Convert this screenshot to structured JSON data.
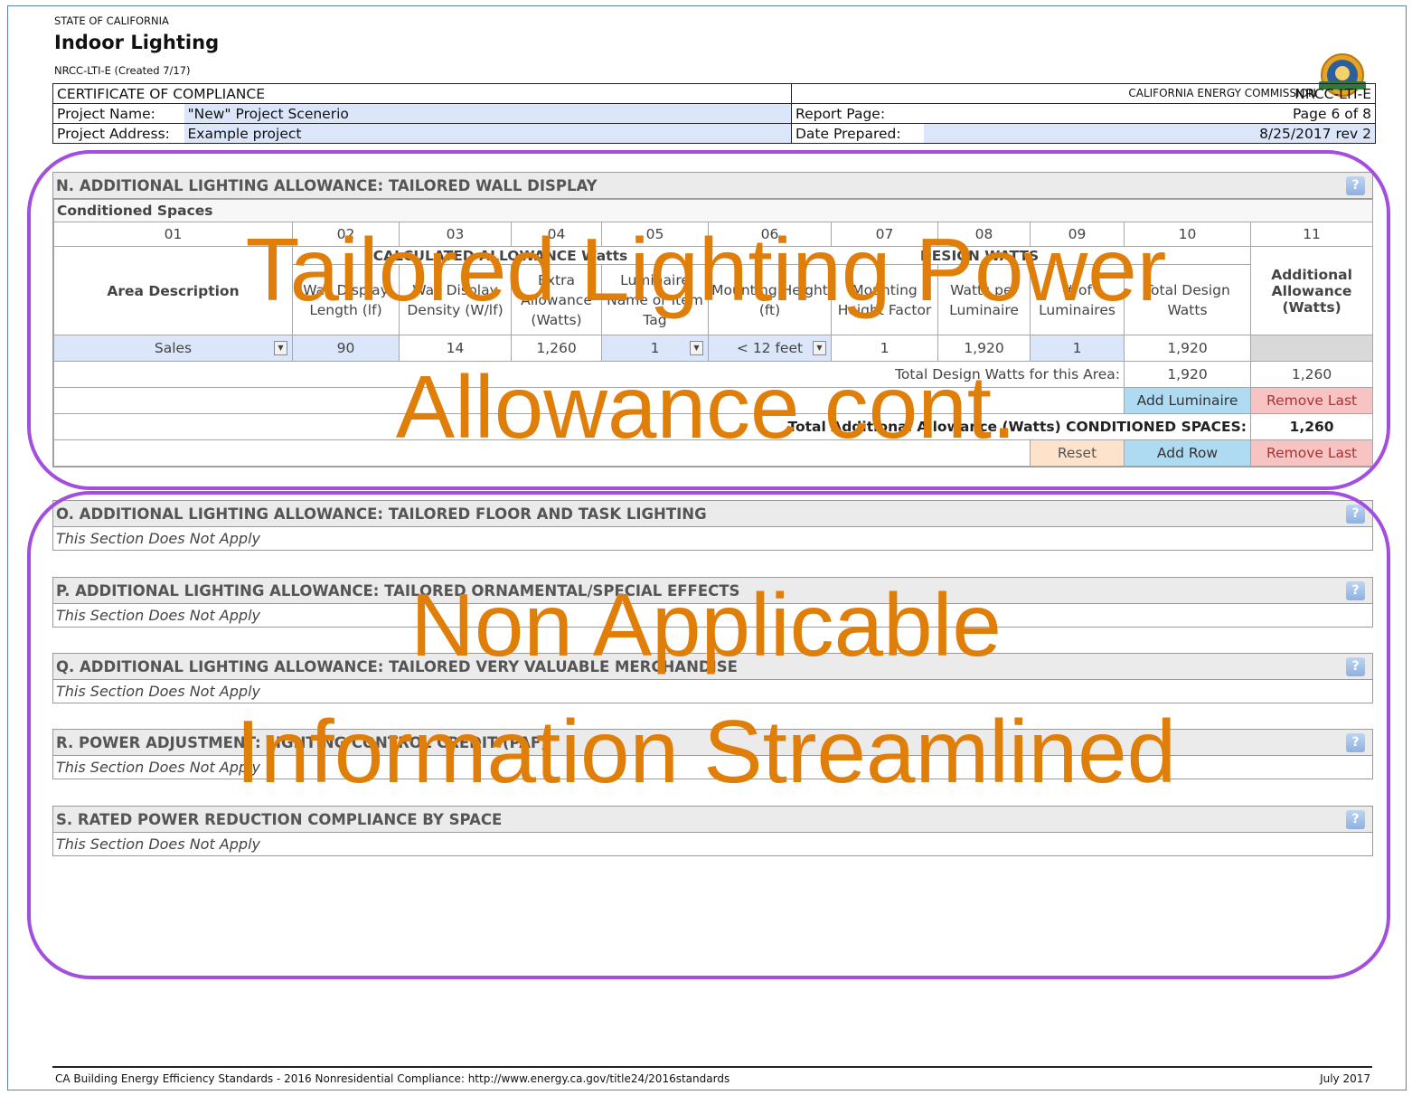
{
  "header": {
    "state": "STATE OF CALIFORNIA",
    "title": "Indoor Lighting",
    "form_id": "NRCC-LTI-E (Created 7/17)",
    "agency": "CALIFORNIA ENERGY COMMISSION",
    "seal_icon": "california-energy-commission-seal-icon"
  },
  "info": {
    "certificate": "CERTIFICATE OF COMPLIANCE",
    "form_code": "NRCC-LTI-E",
    "project_name_label": "Project Name:",
    "project_name": "\"New\" Project Scenerio",
    "report_page_label": "Report Page:",
    "report_page": "Page 6 of 8",
    "project_address_label": "Project Address:",
    "project_address": "Example project",
    "date_prepared_label": "Date Prepared:",
    "date_prepared": "8/25/2017 rev 2"
  },
  "section_n": {
    "title": "N. ADDITIONAL LIGHTING ALLOWANCE: TAILORED WALL DISPLAY",
    "subtitle": "Conditioned Spaces",
    "col_numbers": [
      "01",
      "02",
      "03",
      "04",
      "05",
      "06",
      "07",
      "08",
      "09",
      "10",
      "11"
    ],
    "group_allowance": "CALCULATED ALLOWANCE Watts",
    "group_design": "DESIGN WATTS",
    "col_headers": [
      "Area Description",
      "Wall Display Length (lf)",
      "Wall Display Density (W/lf)",
      "Extra Allowance (Watts)",
      "Luminaire Name or Item Tag",
      "Mounting Height (ft)",
      "Mounting Height Factor",
      "Watts per Luminaire",
      "# of Luminaires",
      "Total Design Watts",
      "Additional Allowance (Watts)"
    ],
    "row": {
      "area": "Sales",
      "length": "90",
      "density": "14",
      "extra": "1,260",
      "tag": "1",
      "height": "< 12 feet",
      "factor": "1",
      "watts_per": "1,920",
      "count": "1",
      "total": "1,920"
    },
    "total_area_label": "Total Design Watts for this Area:",
    "total_area_design": "1,920",
    "total_area_allowance": "1,260",
    "add_luminaire": "Add Luminaire",
    "remove_last": "Remove Last",
    "total_conditioned_label": "Total Additional Allowance (Watts) CONDITIONED SPACES:",
    "total_conditioned": "1,260",
    "reset": "Reset",
    "add_row": "Add Row",
    "remove_last_row": "Remove Last"
  },
  "sections_na": [
    {
      "title": "O. ADDITIONAL LIGHTING ALLOWANCE: TAILORED FLOOR AND TASK LIGHTING",
      "note": "This Section Does Not Apply"
    },
    {
      "title": "P. ADDITIONAL LIGHTING ALLOWANCE: TAILORED ORNAMENTAL/SPECIAL EFFECTS",
      "note": "This Section Does Not Apply"
    },
    {
      "title": "Q. ADDITIONAL LIGHTING ALLOWANCE: TAILORED VERY VALUABLE MERCHANDISE",
      "note": "This Section Does Not Apply"
    },
    {
      "title": "R. POWER ADJUSTMENT: LIGHTING CONTROL CREDIT (PAF)",
      "note": "This Section Does Not Apply"
    },
    {
      "title": "S. RATED POWER REDUCTION COMPLIANCE BY SPACE",
      "note": "This Section Does Not Apply"
    }
  ],
  "help_glyph": "?",
  "help_icon": "help-question-icon",
  "overlays": {
    "top_line1": "Tailored Lighting Power",
    "top_line2": "Allowance cont.",
    "bottom_line1": "Non Applicable",
    "bottom_line2": "Information Streamlined"
  },
  "colors": {
    "callout_border": "#a24fe0",
    "overlay_text": "#e07e0a",
    "input_blue": "#dbe6fb"
  },
  "footer": {
    "left": "CA Building Energy Efficiency Standards - 2016 Nonresidential Compliance: http://www.energy.ca.gov/title24/2016standards",
    "right": "July 2017"
  }
}
